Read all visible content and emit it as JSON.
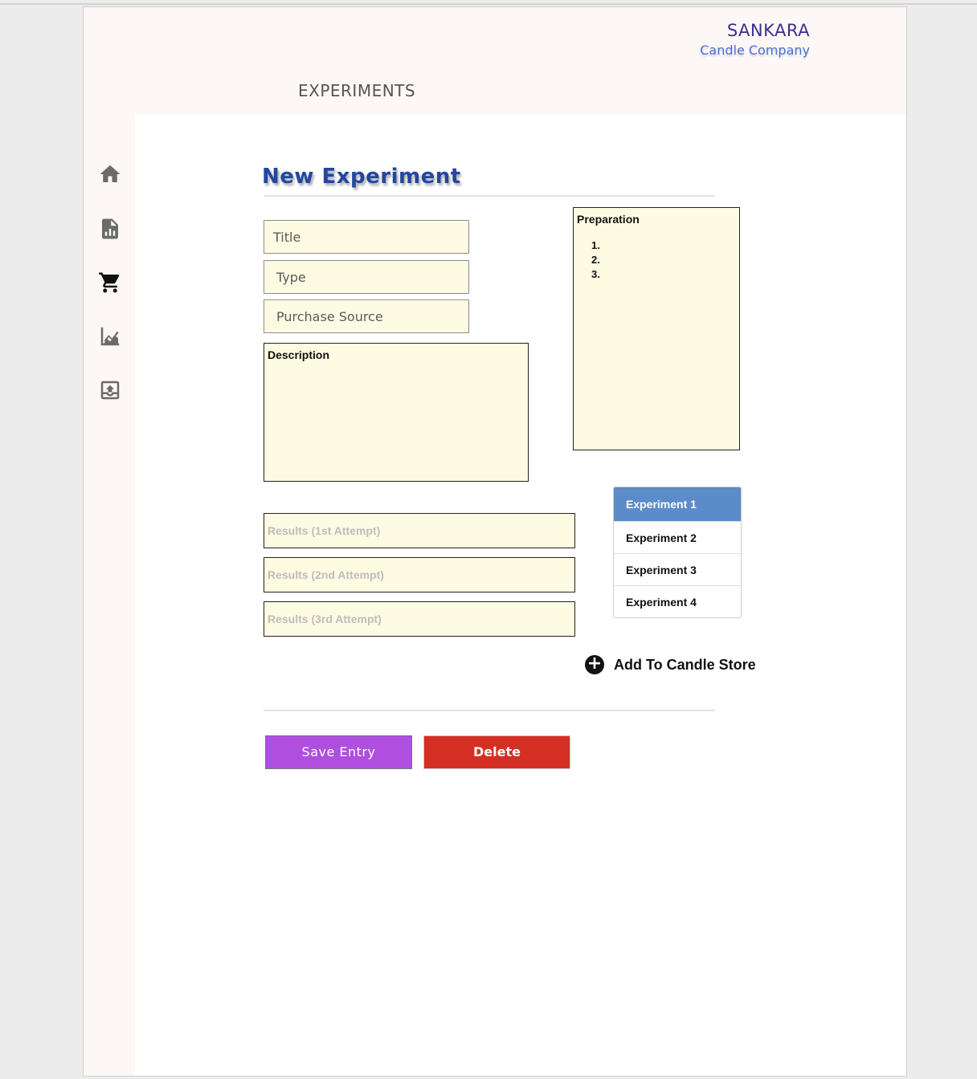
{
  "brand": {
    "name": "SANKARA",
    "subtitle": "Candle Company"
  },
  "header": {
    "section_title": "EXPERIMENTS"
  },
  "sidebar": {
    "items": [
      {
        "icon": "home-icon"
      },
      {
        "icon": "report-icon"
      },
      {
        "icon": "cart-icon"
      },
      {
        "icon": "chart-icon"
      },
      {
        "icon": "upload-icon"
      }
    ]
  },
  "main": {
    "heading": "New Experiment",
    "fields": {
      "title_placeholder": "Title",
      "type_placeholder": "Type",
      "purchase_source_placeholder": "Purchase Source"
    },
    "description": {
      "label": "Description"
    },
    "preparation": {
      "label": "Preparation",
      "steps": [
        "1.",
        "2.",
        "3."
      ]
    },
    "results": [
      {
        "placeholder": "Results (1st Attempt)"
      },
      {
        "placeholder": "Results (2nd Attempt)"
      },
      {
        "placeholder": "Results (3rd Attempt)"
      }
    ],
    "experiments": [
      {
        "label": "Experiment 1",
        "active": true
      },
      {
        "label": "Experiment 2",
        "active": false
      },
      {
        "label": "Experiment 3",
        "active": false
      },
      {
        "label": "Experiment 4",
        "active": false
      }
    ],
    "add_to_store_label": "Add To Candle Store",
    "buttons": {
      "save_label": "Save Entry",
      "delete_label": "Delete"
    }
  },
  "colors": {
    "brand": "#3a2f8e",
    "heading": "#2346a0",
    "field_bg": "#fefbe3",
    "active_item": "#5b8cc9",
    "save_button": "#b04ee0",
    "delete_button": "#d42f22"
  }
}
